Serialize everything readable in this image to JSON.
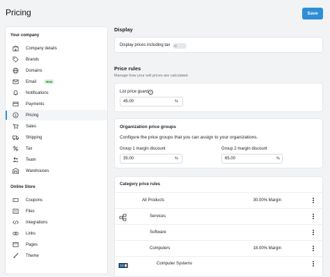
{
  "header": {
    "title": "Pricing",
    "save_label": "Save"
  },
  "sidebar": {
    "company_heading": "Your company",
    "company_items": [
      {
        "label": "Company details",
        "icon": "building-icon"
      },
      {
        "label": "Brands",
        "icon": "tag-icon"
      },
      {
        "label": "Domains",
        "icon": "globe-icon"
      },
      {
        "label": "Email",
        "icon": "envelope-icon",
        "badge": "New"
      },
      {
        "label": "Notifications",
        "icon": "bell-icon"
      },
      {
        "label": "Payments",
        "icon": "credit-card-icon"
      },
      {
        "label": "Pricing",
        "icon": "dollar-circle-icon",
        "active": true
      },
      {
        "label": "Sales",
        "icon": "cart-icon"
      },
      {
        "label": "Shipping",
        "icon": "truck-icon"
      },
      {
        "label": "Tax",
        "icon": "percent-icon"
      },
      {
        "label": "Team",
        "icon": "users-icon"
      },
      {
        "label": "Warehouses",
        "icon": "warehouse-icon"
      }
    ],
    "store_heading": "Online Store",
    "store_items": [
      {
        "label": "Coupons",
        "icon": "coupon-icon"
      },
      {
        "label": "Files",
        "icon": "file-icon"
      },
      {
        "label": "Integrations",
        "icon": "code-icon"
      },
      {
        "label": "Links",
        "icon": "link-icon"
      },
      {
        "label": "Pages",
        "icon": "page-icon"
      },
      {
        "label": "Theme",
        "icon": "brush-icon"
      }
    ]
  },
  "display": {
    "title": "Display",
    "toggle_label": "Display prices including tax",
    "toggle_on": false
  },
  "price_rules": {
    "title": "Price rules",
    "subtitle": "Manage how your sell prices are calculated.",
    "list_price_guard": {
      "label": "List price guard",
      "value": "45.00",
      "suffix": "%"
    }
  },
  "org_groups": {
    "title": "Organization price groups",
    "description": "Configure the price groups that you can assign to your organizations.",
    "group1": {
      "label": "Group 1 margin discount",
      "value": "35.00",
      "suffix": "%"
    },
    "group2": {
      "label": "Group 2 margin discount",
      "value": "65.00",
      "suffix": "%"
    }
  },
  "category_rules": {
    "title": "Category price rules",
    "rows": [
      {
        "name": "All Products",
        "value": "30.00% Margin",
        "indent": 0,
        "has_image": false
      },
      {
        "name": "Services",
        "value": "",
        "indent": 1,
        "has_image": true
      },
      {
        "name": "Software",
        "value": "",
        "indent": 1,
        "has_image": false
      },
      {
        "name": "Computers",
        "value": "18.00% Margin",
        "indent": 1,
        "has_image": false
      },
      {
        "name": "Computer Systems",
        "value": "",
        "indent": 2,
        "has_image": true
      }
    ]
  },
  "colors": {
    "accent": "#2f8fd6",
    "badge_bg": "#d7f2d8",
    "badge_text": "#2a7a35"
  }
}
